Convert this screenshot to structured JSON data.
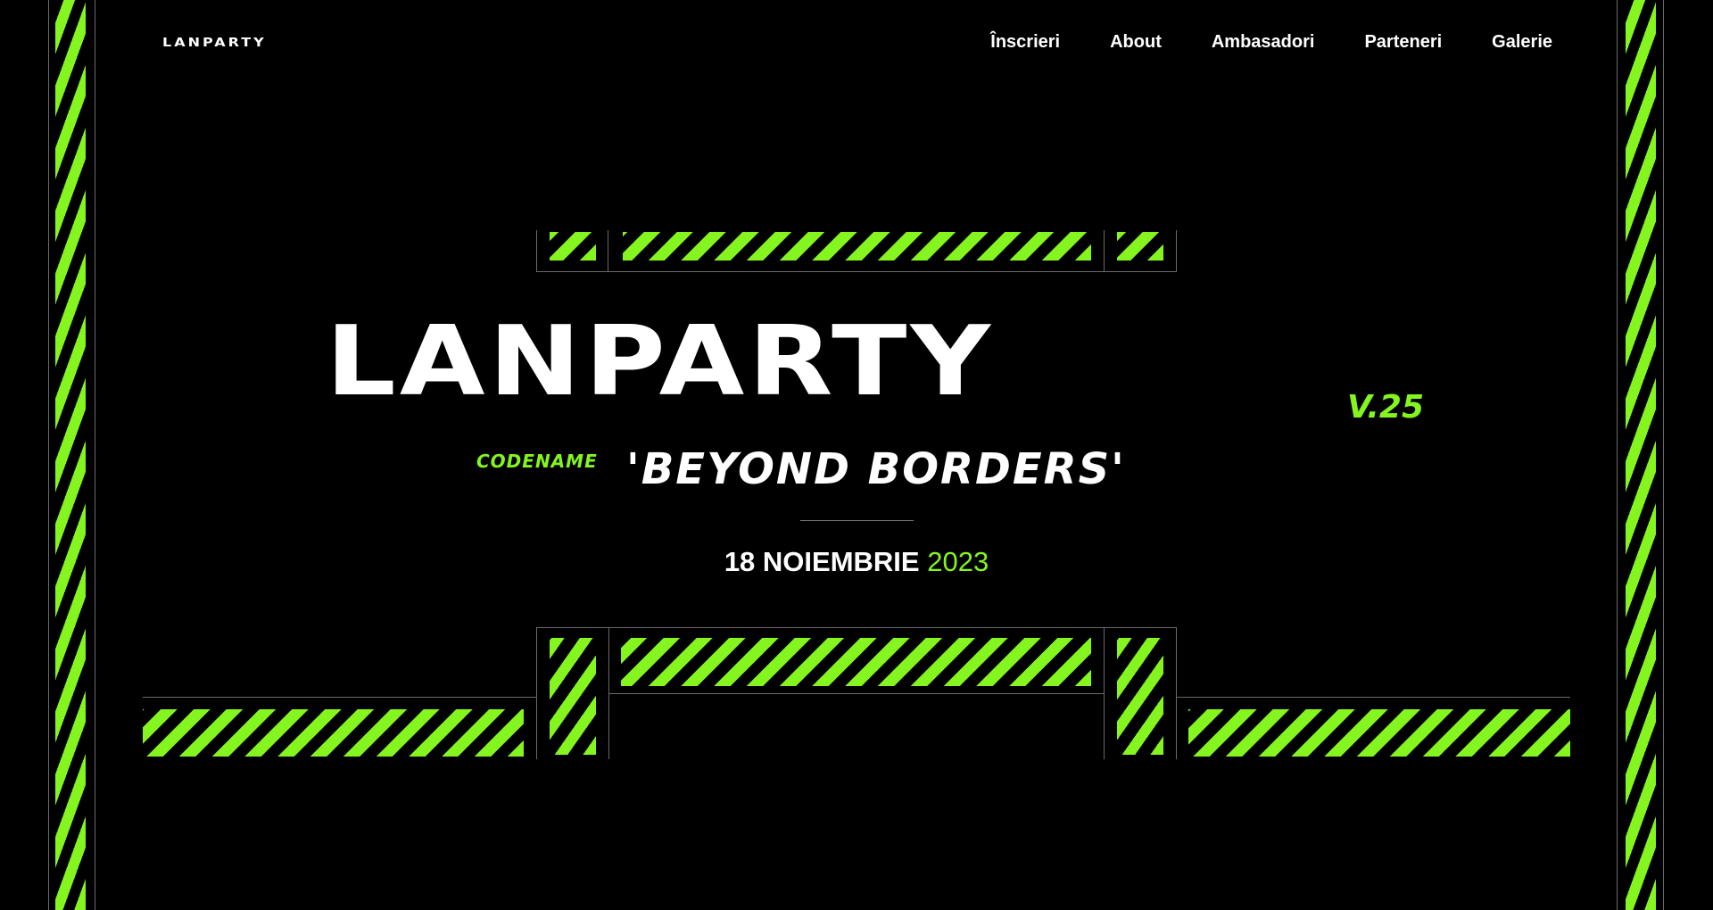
{
  "brand": {
    "logo_text": "LANPARTY"
  },
  "nav": {
    "items": [
      "Înscrieri",
      "About",
      "Ambasadori",
      "Parteneri",
      "Galerie"
    ]
  },
  "hero": {
    "title": "LANPARTY",
    "version": "V.25",
    "codename_label": "CODENAME",
    "codename": "'BEYOND BORDERS'",
    "date_main": "18 NOIEMBRIE",
    "date_year": "2023"
  },
  "colors": {
    "accent": "#84f51e",
    "background": "#000000",
    "text": "#ffffff"
  }
}
